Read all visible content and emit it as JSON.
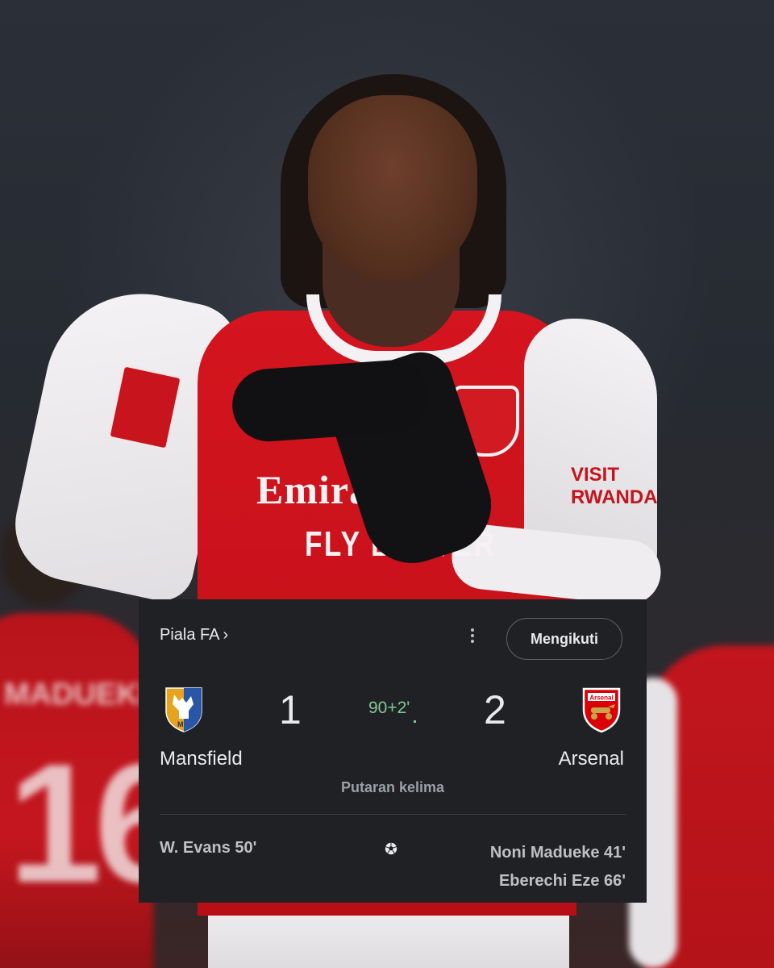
{
  "card": {
    "competition": "Piala FA",
    "competition_chevron": "›",
    "more_icon": "more-vert-icon",
    "follow_label": "Mengikuti",
    "home_team": {
      "name": "Mansfield",
      "score": "1",
      "logo": "mansfield-crest-icon"
    },
    "away_team": {
      "name": "Arsenal",
      "score": "2",
      "logo": "arsenal-crest-icon"
    },
    "match_time": "90+2'",
    "round": "Putaran kelima",
    "home_scorers": [
      "W. Evans 50'"
    ],
    "away_scorers": [
      "Noni Madueke 41'",
      "Eberechi Eze 66'"
    ],
    "goal_icon": "soccer-ball-icon"
  },
  "photo": {
    "jersey_sponsor_line1": "Emirates",
    "jersey_sponsor_line2": "FLY BETTER",
    "sleeve_sponsor": "VISIT RWANDA",
    "crest_text": "Arsenal",
    "background_numbers": "16"
  },
  "colors": {
    "card_bg": "#202124",
    "live_green": "#81c995",
    "jersey_red": "#d4141e",
    "text_primary": "#e8eaed",
    "text_secondary": "#9aa0a6"
  }
}
